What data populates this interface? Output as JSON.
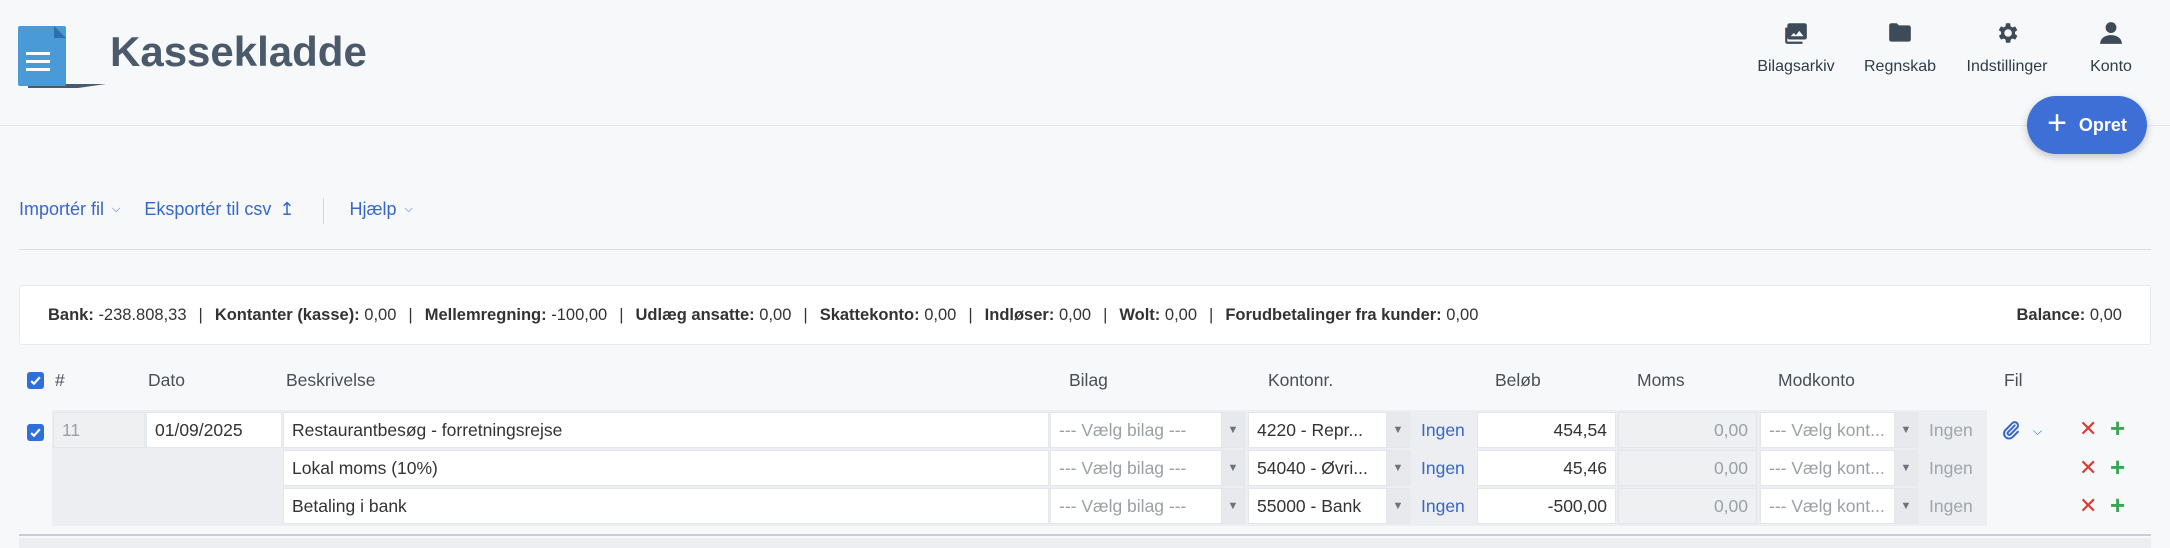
{
  "app": {
    "title": "Kassekladde"
  },
  "nav": {
    "archive": "Bilagsarkiv",
    "accounting": "Regnskab",
    "settings": "Indstillinger",
    "account": "Konto"
  },
  "create_button": {
    "label": "Opret"
  },
  "toolbar": {
    "import": "Importér fil",
    "export": "Eksportér til csv",
    "help": "Hjælp"
  },
  "balances": {
    "items": [
      {
        "label": "Bank:",
        "value": "-238.808,33"
      },
      {
        "label": "Kontanter (kasse):",
        "value": "0,00"
      },
      {
        "label": "Mellemregning:",
        "value": "-100,00"
      },
      {
        "label": "Udlæg ansatte:",
        "value": "0,00"
      },
      {
        "label": "Skattekonto:",
        "value": "0,00"
      },
      {
        "label": "Indløser:",
        "value": "0,00"
      },
      {
        "label": "Wolt:",
        "value": "0,00"
      },
      {
        "label": "Forudbetalinger fra kunder:",
        "value": "0,00"
      }
    ],
    "balance": {
      "label": "Balance:",
      "value": "0,00"
    }
  },
  "table": {
    "headers": {
      "num": "#",
      "date": "Dato",
      "desc": "Beskrivelse",
      "voucher": "Bilag",
      "account": "Kontonr.",
      "amount": "Beløb",
      "vat": "Moms",
      "counter": "Modkonto",
      "file": "Fil"
    },
    "entry": {
      "number": "11",
      "date": "01/09/2025",
      "checked": true,
      "lines": [
        {
          "desc": "Restaurantbesøg - forretningsrejse",
          "voucher": "--- Vælg bilag ---",
          "account": "4220 - Repr...",
          "vat_code": "Ingen",
          "amount": "454,54",
          "vat": "0,00",
          "counter": "--- Vælg kont...",
          "counter_vat": "Ingen"
        },
        {
          "desc": "Lokal moms (10%)",
          "voucher": "--- Vælg bilag ---",
          "account": "54040 - Øvri...",
          "vat_code": "Ingen",
          "amount": "45,46",
          "vat": "0,00",
          "counter": "--- Vælg kont...",
          "counter_vat": "Ingen"
        },
        {
          "desc": "Betaling i bank",
          "voucher": "--- Vælg bilag ---",
          "account": "55000 - Bank",
          "vat_code": "Ingen",
          "amount": "-500,00",
          "vat": "0,00",
          "counter": "--- Vælg kont...",
          "counter_vat": "Ingen"
        }
      ]
    }
  },
  "colors": {
    "accent": "#3d6fd6",
    "link": "#3767c8",
    "delete": "#d93a34",
    "add": "#3aa655"
  },
  "icons": [
    "document-logo-icon",
    "images-icon",
    "folder-icon",
    "gear-icon",
    "user-icon",
    "plus-icon",
    "chevron-down-icon",
    "upload-icon",
    "check-icon",
    "paperclip-icon",
    "close-icon"
  ]
}
